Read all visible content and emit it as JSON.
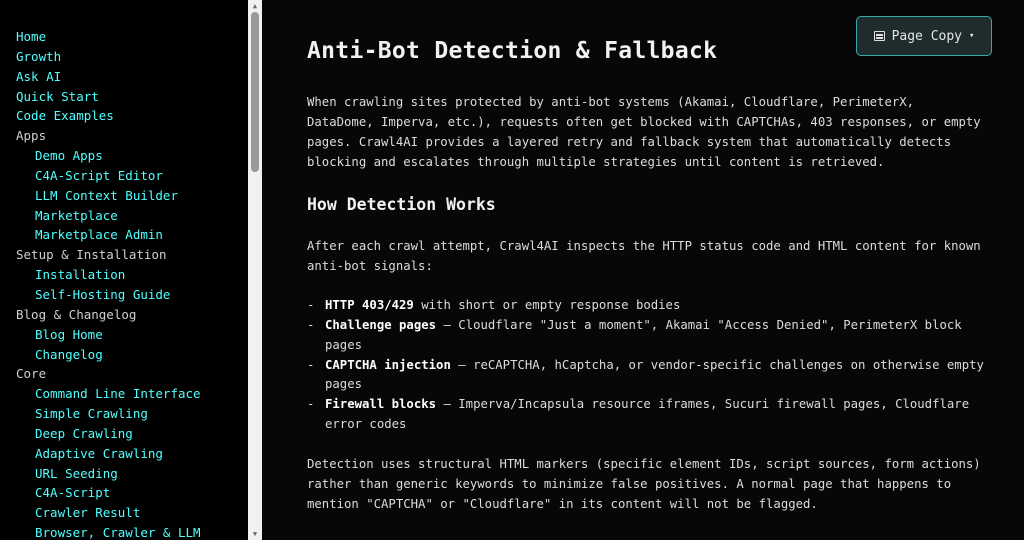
{
  "sidebar": {
    "items": [
      {
        "label": "Home",
        "kind": "link",
        "level": 0
      },
      {
        "label": "Growth",
        "kind": "link",
        "level": 0
      },
      {
        "label": "Ask AI",
        "kind": "link",
        "level": 0
      },
      {
        "label": "Quick Start",
        "kind": "link",
        "level": 0
      },
      {
        "label": "Code Examples",
        "kind": "link",
        "level": 0
      },
      {
        "label": "Apps",
        "kind": "group",
        "level": 0
      },
      {
        "label": "Demo Apps",
        "kind": "link",
        "level": 1
      },
      {
        "label": "C4A-Script Editor",
        "kind": "link",
        "level": 1
      },
      {
        "label": "LLM Context Builder",
        "kind": "link",
        "level": 1
      },
      {
        "label": "Marketplace",
        "kind": "link",
        "level": 1
      },
      {
        "label": "Marketplace Admin",
        "kind": "link",
        "level": 1
      },
      {
        "label": "Setup & Installation",
        "kind": "group",
        "level": 0
      },
      {
        "label": "Installation",
        "kind": "link",
        "level": 1
      },
      {
        "label": "Self-Hosting Guide",
        "kind": "link",
        "level": 1
      },
      {
        "label": "Blog & Changelog",
        "kind": "group",
        "level": 0
      },
      {
        "label": "Blog Home",
        "kind": "link",
        "level": 1
      },
      {
        "label": "Changelog",
        "kind": "link",
        "level": 1
      },
      {
        "label": "Core",
        "kind": "group",
        "level": 0
      },
      {
        "label": "Command Line Interface",
        "kind": "link",
        "level": 1
      },
      {
        "label": "Simple Crawling",
        "kind": "link",
        "level": 1
      },
      {
        "label": "Deep Crawling",
        "kind": "link",
        "level": 1
      },
      {
        "label": "Adaptive Crawling",
        "kind": "link",
        "level": 1
      },
      {
        "label": "URL Seeding",
        "kind": "link",
        "level": 1
      },
      {
        "label": "C4A-Script",
        "kind": "link",
        "level": 1
      },
      {
        "label": "Crawler Result",
        "kind": "link",
        "level": 1
      },
      {
        "label": "Browser, Crawler & LLM",
        "kind": "link",
        "level": 1
      }
    ]
  },
  "toolbar": {
    "page_copy_label": "Page Copy",
    "page_copy_icon": "document-icon",
    "caret": "▾"
  },
  "content": {
    "title": "Anti-Bot Detection & Fallback",
    "intro": "When crawling sites protected by anti-bot systems (Akamai, Cloudflare, PerimeterX, DataDome, Imperva, etc.), requests often get blocked with CAPTCHAs, 403 responses, or empty pages. Crawl4AI provides a layered retry and fallback system that automatically detects blocking and escalates through multiple strategies until content is retrieved.",
    "section_heading": "How Detection Works",
    "section_intro": "After each crawl attempt, Crawl4AI inspects the HTTP status code and HTML content for known anti-bot signals:",
    "signals": [
      {
        "term": "HTTP 403/429",
        "text": " with short or empty response bodies"
      },
      {
        "term": "Challenge pages",
        "text": " — Cloudflare \"Just a moment\", Akamai \"Access Denied\", PerimeterX block pages"
      },
      {
        "term": "CAPTCHA injection",
        "text": " — reCAPTCHA, hCaptcha, or vendor-specific challenges on otherwise empty pages"
      },
      {
        "term": "Firewall blocks",
        "text": " — Imperva/Incapsula resource iframes, Sucuri firewall pages, Cloudflare error codes"
      }
    ],
    "detection_note": "Detection uses structural HTML markers (specific element IDs, script sources, form actions) rather than generic keywords to minimize false positives. A normal page that happens to mention \"CAPTCHA\" or \"Cloudflare\" in its content will not be flagged."
  },
  "colors": {
    "background": "#070708",
    "sidebar_background": "#000000",
    "link": "#50ffff",
    "group_label": "#cfcfcf",
    "text": "#dcdcdc",
    "button_border": "#3aa8a8",
    "button_background": "#1e2c2e"
  }
}
